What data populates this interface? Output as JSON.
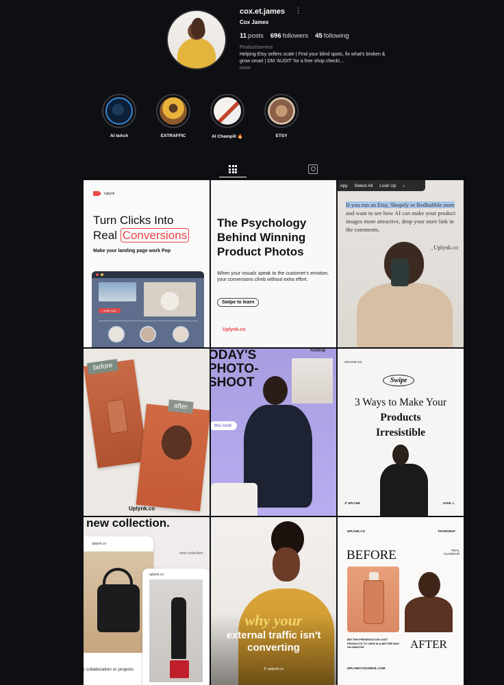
{
  "profile": {
    "username": "cox.et.james",
    "more_icon": "⋮",
    "display_name": "Cox James",
    "posts_count": "11",
    "posts_label": "posts",
    "followers_count": "696",
    "followers_label": "followers",
    "following_count": "45",
    "following_label": "following",
    "category": "Product/service",
    "bio": "Helping Etsy sellers scale | Find your blind spots, fix what's broken & grow smart | DM 'AUDIT' for a free shop check!...",
    "bio_more": "more"
  },
  "highlights": [
    {
      "label": "AI teAch"
    },
    {
      "label": "EXTRAFFIC"
    },
    {
      "label": "AI Champill 🔥"
    },
    {
      "label": "ETSY"
    }
  ],
  "tabs": {
    "posts_icon": "grid-icon",
    "tagged_icon": "tagged-icon"
  },
  "posts": {
    "p1": {
      "brand": "Uplynk",
      "title_line1": "Turn Clicks Into",
      "title_line2_a": "Real ",
      "title_line2_b": "Conversions",
      "subtitle": "Make your landing page work Pop",
      "mock_button": "order now"
    },
    "p2": {
      "title": "The Psychology Behind Winning Product Photos",
      "body": "When your visuals speak to the customer's emotion, your conversions climb without extra effort.",
      "pill": "Swipe to learn",
      "footer": "Uplynk.co"
    },
    "p3": {
      "menu": [
        "opy",
        "Select All",
        "Look Up"
      ],
      "menu_arrow": "›",
      "text_sel": "If you run an Etsy, Shopify or Redbubble store",
      "text_rest": "and want to see how AI can make your product images more attractive, drop your store link in the comments.",
      "sign": "_Uplynk.co"
    },
    "p4": {
      "before": "before",
      "after": "after",
      "footer": "Uplynk.co"
    },
    "p5": {
      "big_line1": "ODAY'S",
      "big_line2": "PHOTO-",
      "big_line3": "SHOOT",
      "airdrop": "AirDrop",
      "bubble": "this look!"
    },
    "p6": {
      "brand": "UPLYNK.CO",
      "swipe": "Swipe",
      "title_line1": "3 Ways to Make Your",
      "title_line2": "Products",
      "title_line3": "Irresistible",
      "footer_left": "✗ UPLYNK",
      "footer_right": "SAVE ⇣"
    },
    "p7": {
      "headline": "new collection.",
      "card_a_label": "uplynk.co",
      "card_b_label": "uplynk.co",
      "nc_label": "new collection",
      "collab": "r collaboration or projects"
    },
    "p8": {
      "why": "why your",
      "line2": "external traffic isn't",
      "line3": "converting",
      "sig": "© uplynk.co"
    },
    "p9": {
      "brand_left": "UPLYNK.CO",
      "brand_right": "THYWORAF",
      "before": "BEFORE",
      "side_text": "REAL GLAMOUR",
      "tiny": "BETTER PRESENTATION JUST PRODUCTS TO VIEW IN A BETTER WAY ON AMAZON",
      "after": "AFTER",
      "email": "UPLYNKCO@GMAIL.COM"
    }
  }
}
